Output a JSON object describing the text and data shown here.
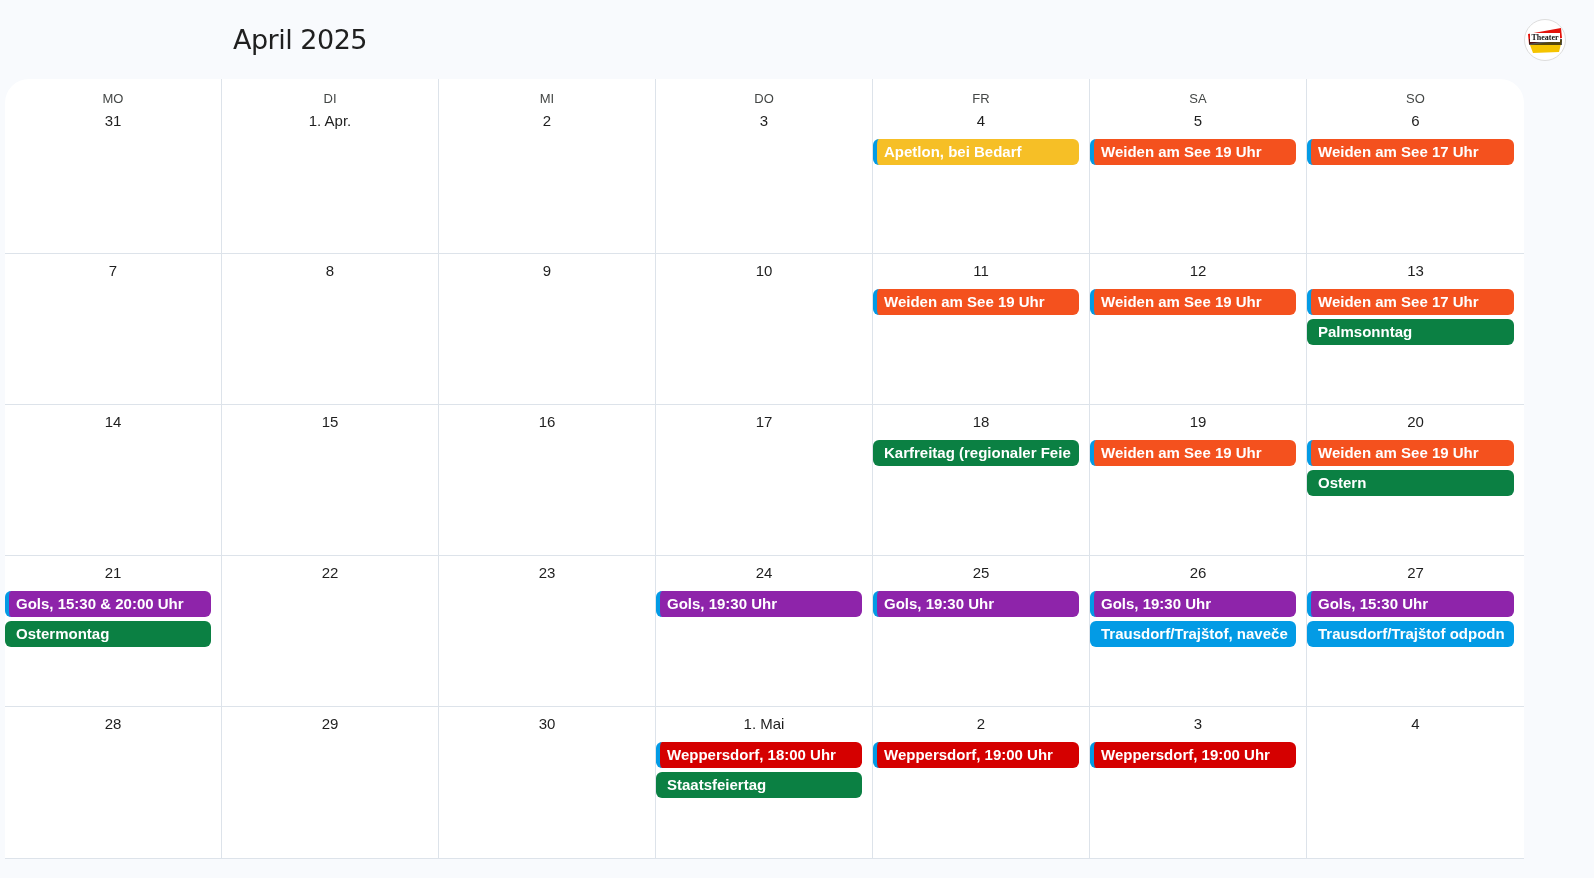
{
  "title": "April 2025",
  "logo": {
    "text": "Theater"
  },
  "weekdays": [
    "MO",
    "DI",
    "MI",
    "DO",
    "FR",
    "SA",
    "SO"
  ],
  "weeks": [
    {
      "days": [
        {
          "label": "31"
        },
        {
          "label": "1. Apr."
        },
        {
          "label": "2"
        },
        {
          "label": "3"
        },
        {
          "label": "4",
          "events": [
            {
              "title": "Apetlon, bei Bedarf",
              "color": "#f6bf26",
              "stripe": true
            }
          ]
        },
        {
          "label": "5",
          "events": [
            {
              "title": "Weiden am See 19 Uhr",
              "color": "#f4511e",
              "stripe": true
            }
          ]
        },
        {
          "label": "6",
          "events": [
            {
              "title": "Weiden am See 17 Uhr",
              "color": "#f4511e",
              "stripe": true
            }
          ]
        }
      ]
    },
    {
      "days": [
        {
          "label": "7"
        },
        {
          "label": "8"
        },
        {
          "label": "9"
        },
        {
          "label": "10"
        },
        {
          "label": "11",
          "events": [
            {
              "title": "Weiden am See 19 Uhr",
              "color": "#f4511e",
              "stripe": true
            }
          ]
        },
        {
          "label": "12",
          "events": [
            {
              "title": "Weiden am See 19 Uhr",
              "color": "#f4511e",
              "stripe": true
            }
          ]
        },
        {
          "label": "13",
          "events": [
            {
              "title": "Weiden am See 17 Uhr",
              "color": "#f4511e",
              "stripe": true
            },
            {
              "title": "Palmsonntag",
              "color": "#0b8043",
              "stripe": false
            }
          ]
        }
      ]
    },
    {
      "days": [
        {
          "label": "14"
        },
        {
          "label": "15"
        },
        {
          "label": "16"
        },
        {
          "label": "17"
        },
        {
          "label": "18",
          "events": [
            {
              "title": "Karfreitag (regionaler Feie",
              "color": "#0b8043",
              "stripe": false
            }
          ]
        },
        {
          "label": "19",
          "events": [
            {
              "title": "Weiden am See 19 Uhr",
              "color": "#f4511e",
              "stripe": true
            }
          ]
        },
        {
          "label": "20",
          "events": [
            {
              "title": "Weiden am See 19 Uhr",
              "color": "#f4511e",
              "stripe": true
            },
            {
              "title": "Ostern",
              "color": "#0b8043",
              "stripe": false
            }
          ]
        }
      ]
    },
    {
      "days": [
        {
          "label": "21",
          "events": [
            {
              "title": "Gols, 15:30 & 20:00 Uhr",
              "color": "#8e24aa",
              "stripe": true
            },
            {
              "title": "Ostermontag",
              "color": "#0b8043",
              "stripe": false
            }
          ]
        },
        {
          "label": "22"
        },
        {
          "label": "23"
        },
        {
          "label": "24",
          "events": [
            {
              "title": "Gols, 19:30 Uhr",
              "color": "#8e24aa",
              "stripe": true
            }
          ]
        },
        {
          "label": "25",
          "events": [
            {
              "title": "Gols, 19:30 Uhr",
              "color": "#8e24aa",
              "stripe": true
            }
          ]
        },
        {
          "label": "26",
          "events": [
            {
              "title": "Gols, 19:30 Uhr",
              "color": "#8e24aa",
              "stripe": true
            },
            {
              "title": "Trausdorf/Trajštof, naveče",
              "color": "#039be5"
            }
          ]
        },
        {
          "label": "27",
          "events": [
            {
              "title": "Gols, 15:30 Uhr",
              "color": "#8e24aa",
              "stripe": true
            },
            {
              "title": "Trausdorf/Trajštof odpodn",
              "color": "#039be5"
            }
          ]
        }
      ]
    },
    {
      "days": [
        {
          "label": "28"
        },
        {
          "label": "29"
        },
        {
          "label": "30"
        },
        {
          "label": "1. Mai",
          "events": [
            {
              "title": "Weppersdorf, 18:00 Uhr",
              "color": "#d50000",
              "stripe": true
            },
            {
              "title": "Staatsfeiertag",
              "color": "#0b8043",
              "stripe": false
            }
          ]
        },
        {
          "label": "2",
          "events": [
            {
              "title": "Weppersdorf, 19:00 Uhr",
              "color": "#d50000",
              "stripe": true
            }
          ]
        },
        {
          "label": "3",
          "events": [
            {
              "title": "Weppersdorf, 19:00 Uhr",
              "color": "#d50000",
              "stripe": true
            }
          ]
        },
        {
          "label": "4"
        }
      ]
    }
  ]
}
